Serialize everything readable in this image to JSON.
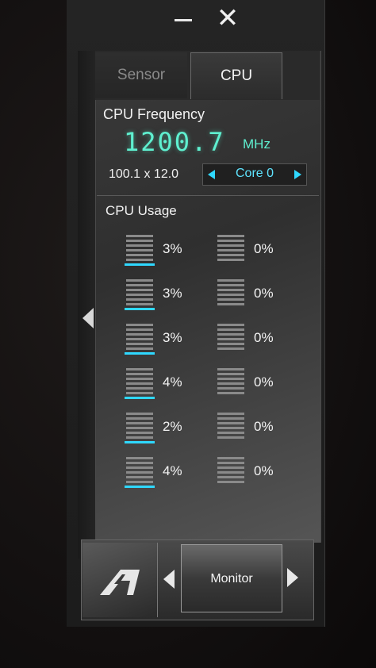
{
  "window": {
    "close_label": "✕"
  },
  "tabs": [
    {
      "label": "Sensor",
      "active": false
    },
    {
      "label": "CPU",
      "active": true
    }
  ],
  "frequency": {
    "title": "CPU Frequency",
    "value": "1200.7",
    "unit": "MHz",
    "multiplier": "100.1 x 12.0",
    "core": "Core 0"
  },
  "usage": {
    "title": "CPU Usage",
    "cores": [
      {
        "value": "3%",
        "fraction": 0.03
      },
      {
        "value": "0%",
        "fraction": 0
      },
      {
        "value": "3%",
        "fraction": 0.03
      },
      {
        "value": "0%",
        "fraction": 0
      },
      {
        "value": "3%",
        "fraction": 0.03
      },
      {
        "value": "0%",
        "fraction": 0
      },
      {
        "value": "4%",
        "fraction": 0.04
      },
      {
        "value": "0%",
        "fraction": 0
      },
      {
        "value": "2%",
        "fraction": 0.02
      },
      {
        "value": "0%",
        "fraction": 0
      },
      {
        "value": "4%",
        "fraction": 0.04
      },
      {
        "value": "0%",
        "fraction": 0
      }
    ]
  },
  "bottom": {
    "monitor_label": "Monitor"
  },
  "icons": {
    "minimize": "minimize-icon",
    "close": "close-icon",
    "collapse": "chevron-left-icon",
    "core_prev": "triangle-left-icon",
    "core_next": "triangle-right-icon",
    "logo": "ai-suite-logo-icon",
    "nav_left": "triangle-left-icon",
    "nav_right": "triangle-right-icon"
  },
  "colors": {
    "accent": "#2fd8ff",
    "frequency": "#5ff0d0"
  }
}
